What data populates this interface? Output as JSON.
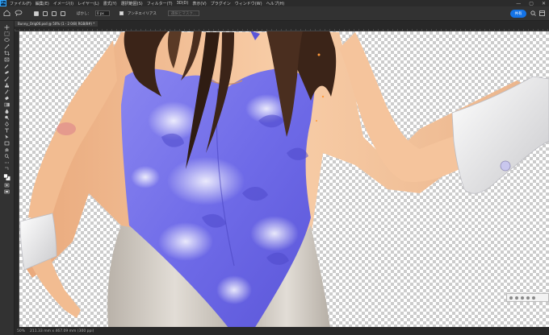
{
  "app": {
    "logo": "Ps"
  },
  "menu": [
    "ファイル(F)",
    "編集(E)",
    "イメージ(I)",
    "レイヤー(L)",
    "書式(Y)",
    "選択範囲(S)",
    "フィルター(T)",
    "3D(D)",
    "表示(V)",
    "プラグイン",
    "ウィンドウ(W)",
    "ヘルプ(H)"
  ],
  "window_controls": {
    "minimize": "—",
    "maximize": "▢",
    "close": "✕"
  },
  "options": {
    "feather_label": "ぼかし：",
    "feather_value": "0 px",
    "antialias_label": "アンチエイリアス",
    "select_mask_label": "選択とマスク...",
    "share_label": "共有"
  },
  "document": {
    "tab_title": "Bunny_Orig00.psd @ 50% (1 - 2 0/8) RGB/8#) *"
  },
  "status": {
    "zoom": "50%",
    "info": "211.33 mm x 467.09 mm (300 ppi)"
  },
  "icons": {
    "toolbar": [
      "move-icon",
      "marquee-icon",
      "lasso-icon",
      "magic-wand-icon",
      "crop-icon",
      "frame-icon",
      "eyedropper-icon",
      "healing-icon",
      "brush-icon",
      "stamp-icon",
      "history-brush-icon",
      "eraser-icon",
      "gradient-icon",
      "blur-icon",
      "dodge-icon",
      "pen-icon",
      "type-icon",
      "path-select-icon",
      "rectangle-icon",
      "hand-icon",
      "zoom-icon",
      "more-icon",
      "swap-colors-icon",
      "color-swatches-icon",
      "quick-mask-icon",
      "screen-mode-icon"
    ]
  },
  "colors": {
    "accent": "#1473e6",
    "leotard": "#6f6be8",
    "skin": "#f6c9a1",
    "hair": "#3b2418"
  }
}
